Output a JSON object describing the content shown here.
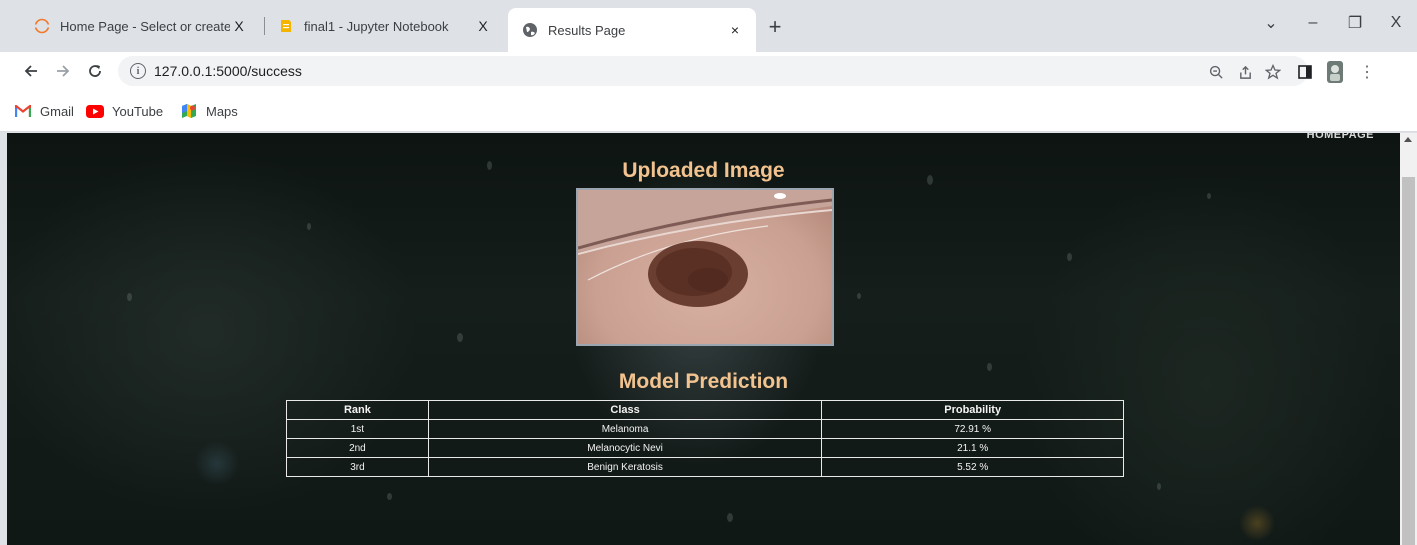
{
  "browser": {
    "tabs": [
      {
        "title": "Home Page - Select or create a n",
        "icon": "jupyter-icon",
        "close": "X"
      },
      {
        "title": "final1 - Jupyter Notebook",
        "icon": "notebook-icon",
        "close": "X"
      },
      {
        "title": "Results Page",
        "icon": "globe-icon",
        "close": "×"
      }
    ],
    "new_tab": "+",
    "window_controls": {
      "dropdown": "⌄",
      "minimize": "–",
      "restore": "❐",
      "close": "X"
    },
    "url": "127.0.0.1:5000/success",
    "bookmarks": [
      {
        "label": "Gmail",
        "icon": "gmail-icon"
      },
      {
        "label": "YouTube",
        "icon": "youtube-icon"
      },
      {
        "label": "Maps",
        "icon": "maps-icon"
      }
    ]
  },
  "page": {
    "nav_link": "HOMEPAGE",
    "uploaded_heading": "Uploaded Image",
    "prediction_heading": "Model Prediction",
    "table": {
      "headers": [
        "Rank",
        "Class",
        "Probability"
      ],
      "rows": [
        [
          "1st",
          "Melanoma",
          "72.91 %"
        ],
        [
          "2nd",
          "Melanocytic Nevi",
          "21.1 %"
        ],
        [
          "3rd",
          "Benign Keratosis",
          "5.52 %"
        ]
      ]
    },
    "heading_color": "#f2c38f"
  }
}
